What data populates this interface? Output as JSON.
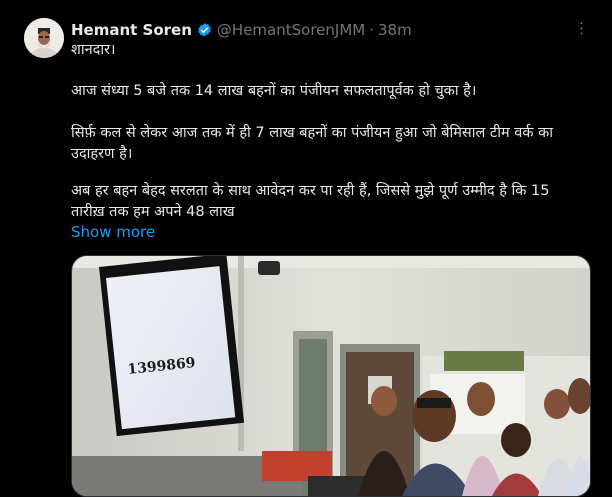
{
  "author": {
    "name": "Hemant Soren",
    "handle": "@HemantSorenJMM",
    "separator": "·",
    "time": "38m",
    "avatar_icon": "profile-avatar",
    "verified_icon": "verified-badge-icon",
    "verified_color": "#1d9bf0"
  },
  "menu": {
    "more_label": "⋮",
    "more_icon": "more-options-icon"
  },
  "tweet": {
    "paragraphs": [
      "शानदार।",
      "आज संध्या 5 बजे तक 14 लाख बहनों का पंजीयन सफलतापूर्वक हो चुका है।",
      "सिर्फ़ कल से लेकर आज तक में ही 7 लाख बहनों का पंजीयन हुआ जो बेमिसाल टीम वर्क का उदाहरण है।",
      "अब हर बहन बेहद सरलता के साथ आवेदन कर पा रही हैं, जिससे मुझे पूर्ण उम्मीद है कि 15 तारीख़ तक हम अपने 48 लाख"
    ],
    "show_more": "Show more",
    "link_color": "#1d9bf0"
  },
  "media": {
    "type": "video-thumbnail",
    "tv_count": "1399869"
  }
}
